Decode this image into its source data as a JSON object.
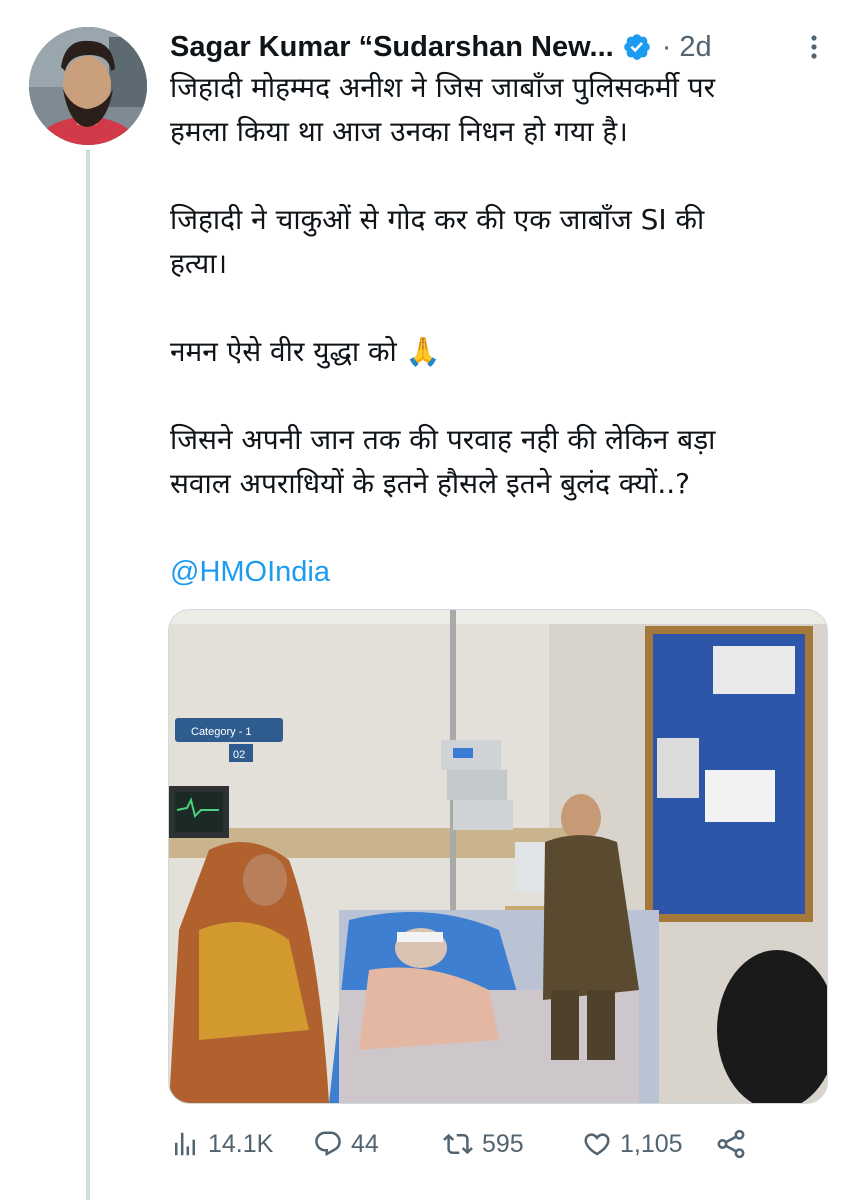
{
  "author": {
    "name": "Sagar Kumar “Sudarshan New...",
    "time": "2d"
  },
  "tweet": {
    "lines": [
      "जिहादी मोहम्मद अनीश ने जिस जाबाँज पुलिसकर्मी पर",
      "हमला किया था आज उनका निधन हो गया है।",
      "जिहादी ने चाकुओं से गोद कर की एक जाबाँज SI की",
      "हत्या।",
      "नमन ऐसे वीर युद्धा को 🙏",
      "जिसने अपनी जान तक की परवाह नही की लेकिन बड़ा",
      "सवाल अपराधियों के इतने हौसले इतने बुलंद क्यों..?"
    ],
    "mention": "@HMOIndia"
  },
  "image": {
    "sign_category": "Category - 1",
    "sign_number": "02"
  },
  "actions": {
    "views": "14.1K",
    "replies": "44",
    "retweets": "595",
    "likes": "1,105"
  },
  "colors": {
    "accent": "#1d9bf0",
    "muted": "#536471",
    "text": "#0f1419",
    "thread_line": "#cfd9de"
  }
}
